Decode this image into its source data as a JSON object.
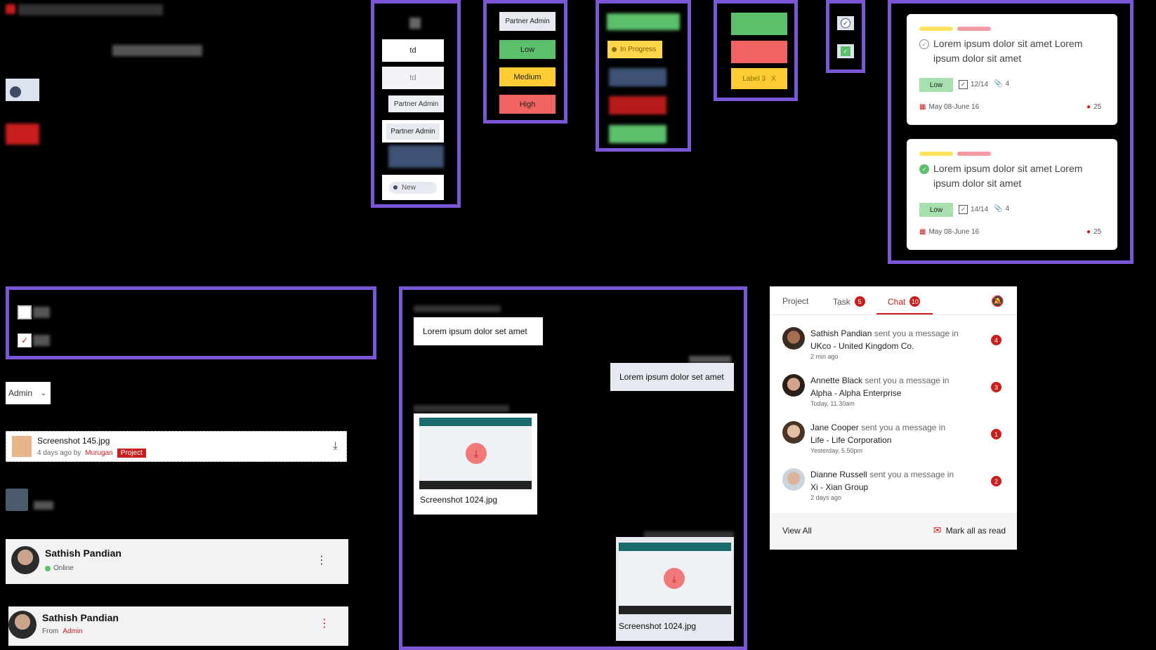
{
  "status_chips": {
    "td_1": "td",
    "td_2": "td",
    "partner_admin_1": "Partner Admin",
    "partner_admin_2": "Partner Admin",
    "new": "New"
  },
  "priority_chips": {
    "partner_admin": "Partner Admin",
    "low": "Low",
    "medium": "Medium",
    "high": "High"
  },
  "progress_chips": {
    "in_progress": "In Progress"
  },
  "label_chips": {
    "label_3": "Label 3",
    "remove": "X"
  },
  "task_cards": [
    {
      "title": "Lorem ipsum dolor sit amet Lorem ipsum dolor sit amet",
      "priority": "Low",
      "checklist": "12/14",
      "attachments": "4",
      "dates": "May 08-June 16",
      "comments": "25"
    },
    {
      "title": "Lorem ipsum dolor sit amet Lorem ipsum dolor sit amet",
      "priority": "Low",
      "checklist": "14/14",
      "attachments": "4",
      "dates": "May 08-June 16",
      "comments": "25"
    }
  ],
  "admin_select": "Admin",
  "file_item": {
    "name": "Screenshot 145.jpg",
    "meta": "4 days ago by",
    "author": "Murugan",
    "tag": "Project"
  },
  "profile_online": {
    "name": "Sathish Pandian",
    "status": "Online"
  },
  "profile_from": {
    "name": "Sathish Pandian",
    "from_label": "From",
    "role": "Admin"
  },
  "chat": {
    "message_1": "Lorem  ipsum dolor set amet",
    "message_2": "Lorem  ipsum dolor set amet",
    "attachment_1": "Screenshot 1024.jpg",
    "attachment_2": "Screenshot 1024.jpg"
  },
  "notifications": {
    "tabs": [
      {
        "label": "Project"
      },
      {
        "label": "Task",
        "count": "5"
      },
      {
        "label": "Chat",
        "count": "10"
      }
    ],
    "items": [
      {
        "name": "Sathish Pandian",
        "action": "sent you a message in",
        "org": "UKco - United Kingdom Co.",
        "time": "2 min ago",
        "count": "4"
      },
      {
        "name": "Annette Black",
        "action": "sent you a message in",
        "org": "Alpha - Alpha Enterprise",
        "time": "Today, 11.30am",
        "count": "3"
      },
      {
        "name": "Jane Cooper",
        "action": "sent you a message in",
        "org": "Life - Life Corporation",
        "time": "Yesterday, 5.50pm",
        "count": "1"
      },
      {
        "name": "Dianne Russell",
        "action": "sent you a message in",
        "org": "Xi - Xian Group",
        "time": "2 days ago",
        "count": "2"
      }
    ],
    "view_all": "View All",
    "mark_all_read": "Mark all as read"
  },
  "colors": {
    "accent_red": "#c81e1e",
    "frame_purple": "#7c57d6",
    "low_green": "#5bbf6b",
    "medium_yellow": "#ffcc33",
    "high_red": "#f26363"
  }
}
